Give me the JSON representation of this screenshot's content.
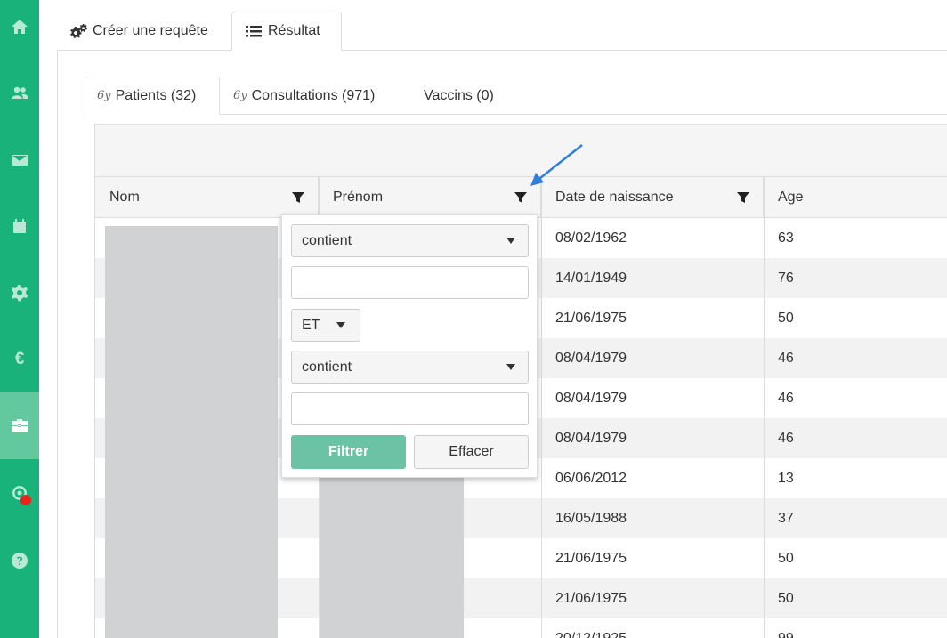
{
  "sidebar": {
    "items": [
      {
        "icon": "home-icon"
      },
      {
        "icon": "users-icon"
      },
      {
        "icon": "envelope-icon"
      },
      {
        "icon": "calendar-icon"
      },
      {
        "icon": "gear-icon"
      },
      {
        "icon": "euro-icon",
        "label": "€"
      },
      {
        "icon": "briefcase-icon",
        "active": true
      },
      {
        "icon": "broadcast-icon",
        "badge_color": "#e8241b"
      },
      {
        "icon": "help-icon"
      }
    ],
    "color": "#19b27a"
  },
  "top_tabs": [
    {
      "label": "Créer une requête",
      "icon": "gears-icon"
    },
    {
      "label": "Résultat",
      "icon": "list-icon",
      "active": true
    }
  ],
  "sub_tabs": [
    {
      "label": "Patients (32)",
      "icon_text": "6y",
      "active": true
    },
    {
      "label": "Consultations (971)",
      "icon_text": "6y"
    },
    {
      "label": "Vaccins (0)"
    }
  ],
  "grid": {
    "columns": [
      {
        "label": "Nom",
        "filter": true
      },
      {
        "label": "Prénom",
        "filter": true
      },
      {
        "label": "Date de naissance",
        "filter": true
      },
      {
        "label": "Age",
        "filter": false
      }
    ],
    "rows": [
      {
        "date": "08/02/1962",
        "age": "63"
      },
      {
        "date": "14/01/1949",
        "age": "76"
      },
      {
        "date": "21/06/1975",
        "age": "50"
      },
      {
        "date": "08/04/1979",
        "age": "46"
      },
      {
        "date": "08/04/1979",
        "age": "46"
      },
      {
        "date": "08/04/1979",
        "age": "46"
      },
      {
        "date": "06/06/2012",
        "age": "13"
      },
      {
        "date": "16/05/1988",
        "age": "37"
      },
      {
        "date": "21/06/1975",
        "age": "50"
      },
      {
        "date": "21/06/1975",
        "age": "50"
      },
      {
        "date": "20/12/1925",
        "age": "99"
      }
    ]
  },
  "filter_popup": {
    "condition1": "contient",
    "value1": "",
    "operator": "ET",
    "condition2": "contient",
    "value2": "",
    "apply_label": "Filtrer",
    "clear_label": "Effacer",
    "apply_color": "#6cc2a5"
  },
  "annotation": {
    "arrow_color": "#2f7ee0"
  }
}
